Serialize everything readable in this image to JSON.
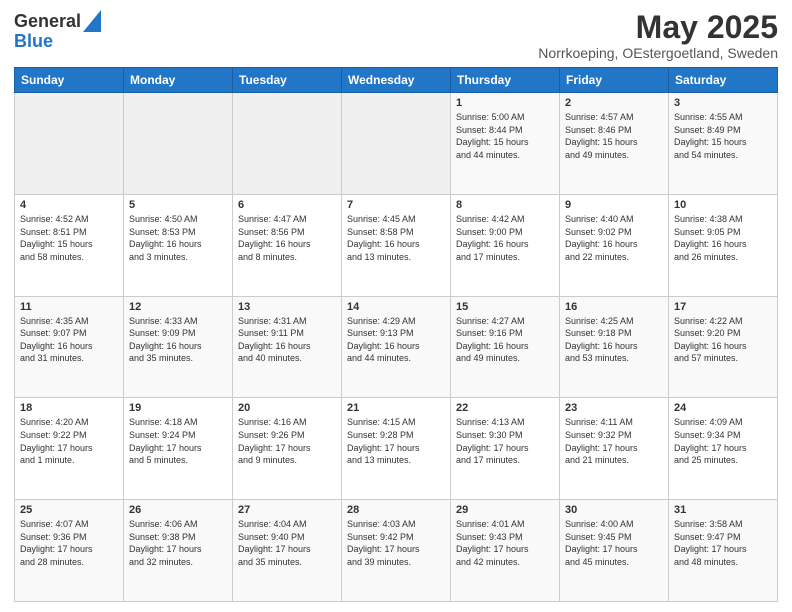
{
  "header": {
    "logo_general": "General",
    "logo_blue": "Blue",
    "title": "May 2025",
    "subtitle": "Norrkoeping, OEstergoetland, Sweden"
  },
  "weekdays": [
    "Sunday",
    "Monday",
    "Tuesday",
    "Wednesday",
    "Thursday",
    "Friday",
    "Saturday"
  ],
  "weeks": [
    [
      {
        "day": "",
        "info": ""
      },
      {
        "day": "",
        "info": ""
      },
      {
        "day": "",
        "info": ""
      },
      {
        "day": "",
        "info": ""
      },
      {
        "day": "1",
        "info": "Sunrise: 5:00 AM\nSunset: 8:44 PM\nDaylight: 15 hours\nand 44 minutes."
      },
      {
        "day": "2",
        "info": "Sunrise: 4:57 AM\nSunset: 8:46 PM\nDaylight: 15 hours\nand 49 minutes."
      },
      {
        "day": "3",
        "info": "Sunrise: 4:55 AM\nSunset: 8:49 PM\nDaylight: 15 hours\nand 54 minutes."
      }
    ],
    [
      {
        "day": "4",
        "info": "Sunrise: 4:52 AM\nSunset: 8:51 PM\nDaylight: 15 hours\nand 58 minutes."
      },
      {
        "day": "5",
        "info": "Sunrise: 4:50 AM\nSunset: 8:53 PM\nDaylight: 16 hours\nand 3 minutes."
      },
      {
        "day": "6",
        "info": "Sunrise: 4:47 AM\nSunset: 8:56 PM\nDaylight: 16 hours\nand 8 minutes."
      },
      {
        "day": "7",
        "info": "Sunrise: 4:45 AM\nSunset: 8:58 PM\nDaylight: 16 hours\nand 13 minutes."
      },
      {
        "day": "8",
        "info": "Sunrise: 4:42 AM\nSunset: 9:00 PM\nDaylight: 16 hours\nand 17 minutes."
      },
      {
        "day": "9",
        "info": "Sunrise: 4:40 AM\nSunset: 9:02 PM\nDaylight: 16 hours\nand 22 minutes."
      },
      {
        "day": "10",
        "info": "Sunrise: 4:38 AM\nSunset: 9:05 PM\nDaylight: 16 hours\nand 26 minutes."
      }
    ],
    [
      {
        "day": "11",
        "info": "Sunrise: 4:35 AM\nSunset: 9:07 PM\nDaylight: 16 hours\nand 31 minutes."
      },
      {
        "day": "12",
        "info": "Sunrise: 4:33 AM\nSunset: 9:09 PM\nDaylight: 16 hours\nand 35 minutes."
      },
      {
        "day": "13",
        "info": "Sunrise: 4:31 AM\nSunset: 9:11 PM\nDaylight: 16 hours\nand 40 minutes."
      },
      {
        "day": "14",
        "info": "Sunrise: 4:29 AM\nSunset: 9:13 PM\nDaylight: 16 hours\nand 44 minutes."
      },
      {
        "day": "15",
        "info": "Sunrise: 4:27 AM\nSunset: 9:16 PM\nDaylight: 16 hours\nand 49 minutes."
      },
      {
        "day": "16",
        "info": "Sunrise: 4:25 AM\nSunset: 9:18 PM\nDaylight: 16 hours\nand 53 minutes."
      },
      {
        "day": "17",
        "info": "Sunrise: 4:22 AM\nSunset: 9:20 PM\nDaylight: 16 hours\nand 57 minutes."
      }
    ],
    [
      {
        "day": "18",
        "info": "Sunrise: 4:20 AM\nSunset: 9:22 PM\nDaylight: 17 hours\nand 1 minute."
      },
      {
        "day": "19",
        "info": "Sunrise: 4:18 AM\nSunset: 9:24 PM\nDaylight: 17 hours\nand 5 minutes."
      },
      {
        "day": "20",
        "info": "Sunrise: 4:16 AM\nSunset: 9:26 PM\nDaylight: 17 hours\nand 9 minutes."
      },
      {
        "day": "21",
        "info": "Sunrise: 4:15 AM\nSunset: 9:28 PM\nDaylight: 17 hours\nand 13 minutes."
      },
      {
        "day": "22",
        "info": "Sunrise: 4:13 AM\nSunset: 9:30 PM\nDaylight: 17 hours\nand 17 minutes."
      },
      {
        "day": "23",
        "info": "Sunrise: 4:11 AM\nSunset: 9:32 PM\nDaylight: 17 hours\nand 21 minutes."
      },
      {
        "day": "24",
        "info": "Sunrise: 4:09 AM\nSunset: 9:34 PM\nDaylight: 17 hours\nand 25 minutes."
      }
    ],
    [
      {
        "day": "25",
        "info": "Sunrise: 4:07 AM\nSunset: 9:36 PM\nDaylight: 17 hours\nand 28 minutes."
      },
      {
        "day": "26",
        "info": "Sunrise: 4:06 AM\nSunset: 9:38 PM\nDaylight: 17 hours\nand 32 minutes."
      },
      {
        "day": "27",
        "info": "Sunrise: 4:04 AM\nSunset: 9:40 PM\nDaylight: 17 hours\nand 35 minutes."
      },
      {
        "day": "28",
        "info": "Sunrise: 4:03 AM\nSunset: 9:42 PM\nDaylight: 17 hours\nand 39 minutes."
      },
      {
        "day": "29",
        "info": "Sunrise: 4:01 AM\nSunset: 9:43 PM\nDaylight: 17 hours\nand 42 minutes."
      },
      {
        "day": "30",
        "info": "Sunrise: 4:00 AM\nSunset: 9:45 PM\nDaylight: 17 hours\nand 45 minutes."
      },
      {
        "day": "31",
        "info": "Sunrise: 3:58 AM\nSunset: 9:47 PM\nDaylight: 17 hours\nand 48 minutes."
      }
    ]
  ]
}
